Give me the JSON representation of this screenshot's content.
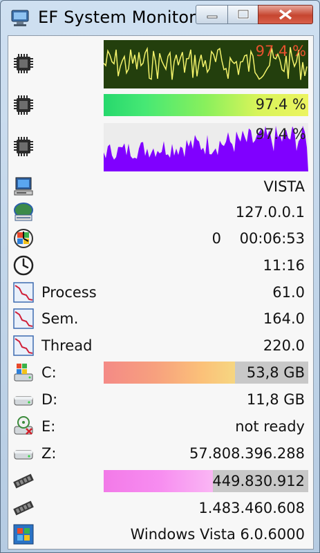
{
  "window": {
    "title": "EF System Monitor"
  },
  "cpu": {
    "graph_percent": "97.4 %",
    "bar_percent": "97.4 %",
    "bar_value": 97.4,
    "histogram_percent": "97.4 %"
  },
  "info": {
    "computer": "VISTA",
    "ip": "127.0.0.1",
    "uptime": "0    00:06:53",
    "clock": "11:16"
  },
  "counters": [
    {
      "label": "Process",
      "value": "61.0"
    },
    {
      "label": "Sem.",
      "value": "164.0"
    },
    {
      "label": "Thread",
      "value": "220.0"
    }
  ],
  "drives": [
    {
      "label": "C:",
      "value": "53,8 GB"
    },
    {
      "label": "D:",
      "value": "11,8 GB"
    },
    {
      "label": "E:",
      "value": "not ready"
    },
    {
      "label": "Z:",
      "value": "57.808.396.288"
    }
  ],
  "memory": {
    "physical": "449.830.912",
    "virtual": "1.483.460.608"
  },
  "os": "Windows Vista 6.0.6000",
  "colors": {
    "graph_bg": "#233f0d",
    "graph_line": "#f2f26a",
    "graph_text": "#e8522e",
    "histogram": "#8000ff"
  }
}
